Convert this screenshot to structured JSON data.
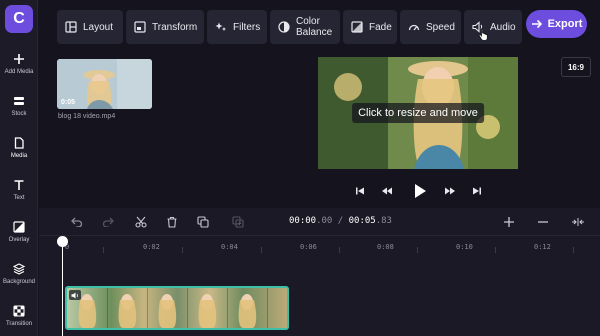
{
  "app": {
    "logo_letter": "C"
  },
  "sidebar": {
    "items": [
      {
        "label": "Add Media",
        "icon": "plus-icon"
      },
      {
        "label": "Stock",
        "icon": "stock-icon"
      },
      {
        "label": "Media",
        "icon": "file-icon"
      },
      {
        "label": "Text",
        "icon": "text-icon"
      },
      {
        "label": "Overlay",
        "icon": "overlay-icon"
      },
      {
        "label": "Background",
        "icon": "layers-icon"
      },
      {
        "label": "Transition",
        "icon": "transition-icon"
      }
    ],
    "active": "Media"
  },
  "toolbar": {
    "buttons": [
      {
        "label": "Layout",
        "icon": "layout-icon"
      },
      {
        "label": "Transform",
        "icon": "transform-icon"
      },
      {
        "label": "Filters",
        "icon": "sparkle-icon"
      },
      {
        "label": "Color\nBalance",
        "label_line1": "Color",
        "label_line2": "Balance",
        "icon": "color-balance-icon"
      },
      {
        "label": "Fade",
        "icon": "fade-icon"
      },
      {
        "label": "Speed",
        "icon": "speedometer-icon"
      },
      {
        "label": "Audio",
        "icon": "speaker-icon"
      }
    ],
    "export_label": "Export",
    "aspect_ratio": "16:9"
  },
  "media": {
    "clip_name": "blog 18 video.mp4",
    "clip_duration": "0:05"
  },
  "preview": {
    "hint": "Click to resize and move"
  },
  "timeline": {
    "current_time": "00:00",
    "current_time_frac": ".00",
    "separator": " / ",
    "total_time": "00:05",
    "total_time_frac": ".83",
    "ruler_labels": [
      "0",
      "0:02",
      "0:04",
      "0:06",
      "0:08",
      "0:10",
      "0:12"
    ]
  },
  "colors": {
    "accent": "#6c4dde",
    "clip_border": "#3fbfa5",
    "background": "#15141e"
  }
}
